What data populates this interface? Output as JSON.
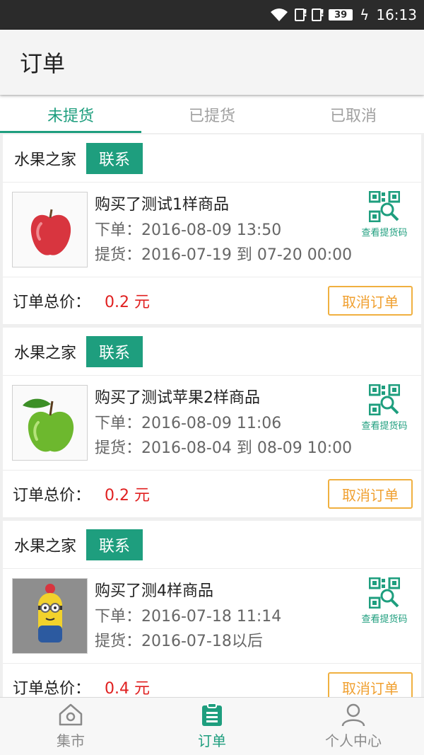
{
  "status_bar": {
    "battery": "39",
    "time": "16:13"
  },
  "header": {
    "title": "订单"
  },
  "tabs": [
    {
      "label": "未提货",
      "active": true
    },
    {
      "label": "已提货",
      "active": false
    },
    {
      "label": "已取消",
      "active": false
    }
  ],
  "orders": [
    {
      "shop": "水果之家",
      "contact_label": "联系",
      "product_image": "red-apple",
      "title": "购买了测试1样商品",
      "order_time": "下单：2016-08-09 13:50",
      "pickup_time": "提货：2016-07-19 到 07-20 00:00",
      "qr_label": "查看提货码",
      "total_label": "订单总价：",
      "total_value": "0.2 元",
      "cancel_label": "取消订单"
    },
    {
      "shop": "水果之家",
      "contact_label": "联系",
      "product_image": "green-apple",
      "title": "购买了测试苹果2样商品",
      "order_time": "下单：2016-08-09 11:06",
      "pickup_time": "提货：2016-08-04 到 08-09 10:00",
      "qr_label": "查看提货码",
      "total_label": "订单总价：",
      "total_value": "0.2 元",
      "cancel_label": "取消订单"
    },
    {
      "shop": "水果之家",
      "contact_label": "联系",
      "product_image": "minion-with-apple",
      "title": "购买了测4样商品",
      "order_time": "下单：2016-07-18 11:14",
      "pickup_time": "提货：2016-07-18以后",
      "qr_label": "查看提货码",
      "total_label": "订单总价：",
      "total_value": "0.4 元",
      "cancel_label": "取消订单"
    }
  ],
  "bottom_nav": [
    {
      "label": "集市",
      "icon": "home-icon",
      "active": false
    },
    {
      "label": "订单",
      "icon": "clipboard-icon",
      "active": true
    },
    {
      "label": "个人中心",
      "icon": "person-icon",
      "active": false
    }
  ],
  "colors": {
    "accent": "#1e9e7e",
    "price": "#e02020",
    "cancel": "#f0a030"
  }
}
